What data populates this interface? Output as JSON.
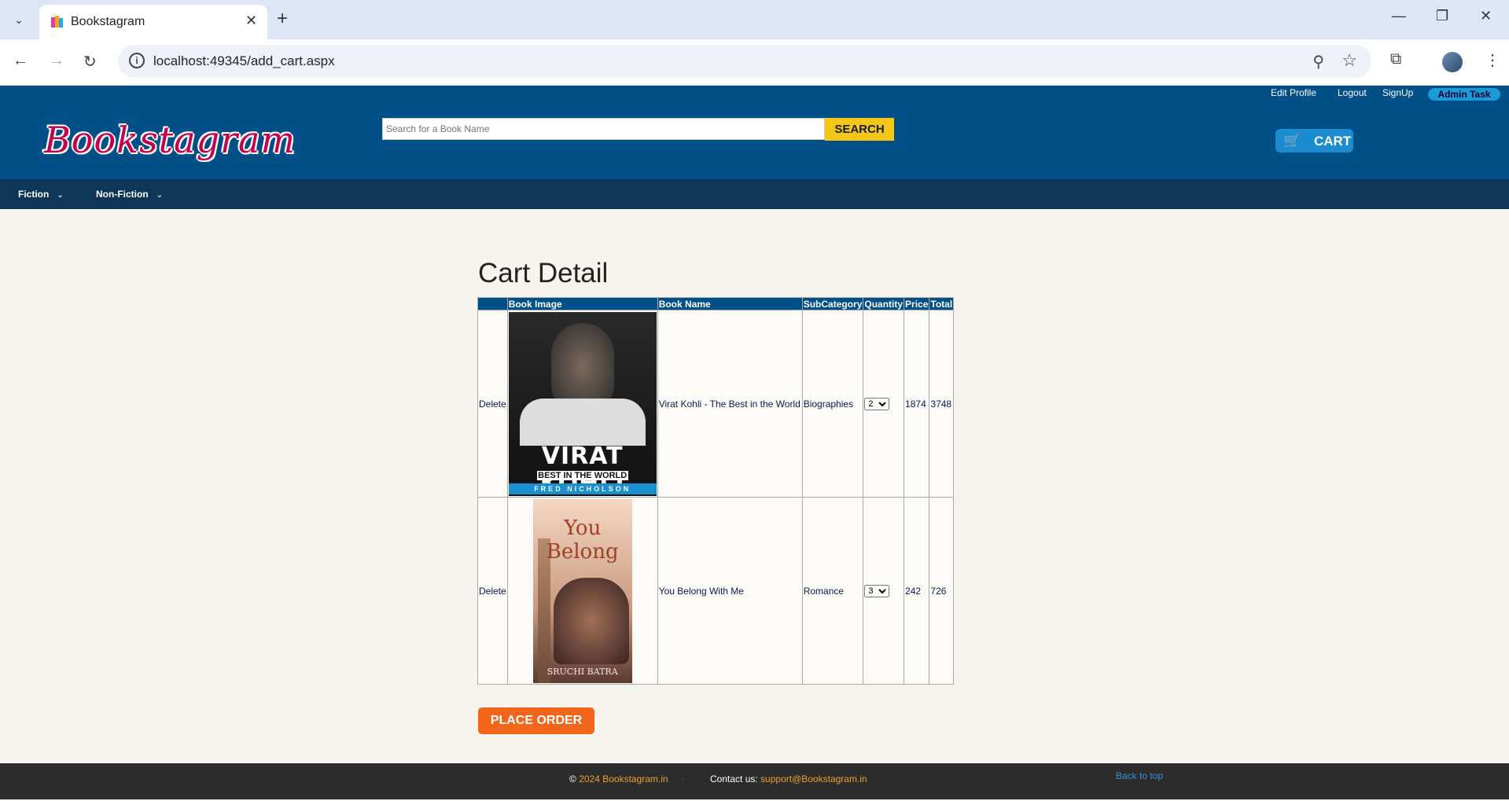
{
  "browser": {
    "tab_title": "Bookstagram",
    "url": "localhost:49345/add_cart.aspx"
  },
  "header": {
    "top_links": [
      "Edit Profile",
      "Logout",
      "SignUp"
    ],
    "admin_badge": "Admin Task",
    "logo_text": "Bookstagram",
    "search_placeholder": "Search for a Book Name",
    "search_button": "SEARCH",
    "cart_button": "CART"
  },
  "nav": {
    "items": [
      "Fiction",
      "Non-Fiction"
    ]
  },
  "main": {
    "title": "Cart Detail",
    "columns": [
      "",
      "Book Image",
      "Book Name",
      "SubCategory",
      "Quantity",
      "Price",
      "Total"
    ],
    "rows": [
      {
        "action": "Delete",
        "cover_title": "VIRAT KOHLI",
        "cover_subtitle": "BEST IN THE WORLD",
        "cover_author": "FRED NICHOLSON",
        "name": "Virat Kohli - The Best in the World",
        "subcategory": "Biographies",
        "quantity": "2",
        "price": "1874",
        "total": "3748"
      },
      {
        "action": "Delete",
        "cover_title": "You Belong",
        "cover_author": "SRUCHI BATRA",
        "name": "You Belong With Me",
        "subcategory": "Romance",
        "quantity": "3",
        "price": "242",
        "total": "726"
      }
    ],
    "place_order": "PLACE ORDER"
  },
  "footer": {
    "copyright_symbol": "©",
    "copyright_text": "2024 Bookstagram.in",
    "dot": "·",
    "contact_label": "Contact us:",
    "contact_email": "support@Bookstagram.in",
    "back_to_top": "Back to top"
  }
}
